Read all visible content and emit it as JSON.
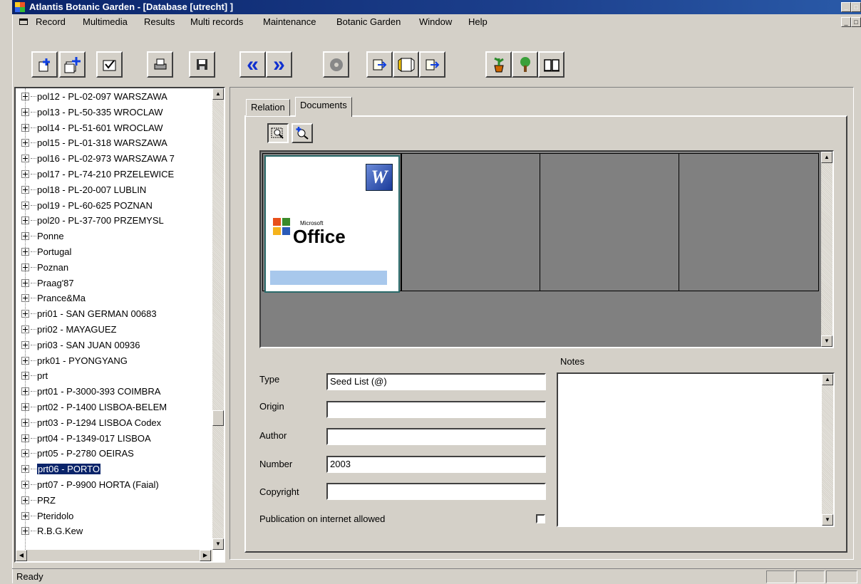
{
  "window": {
    "title": "Atlantis Botanic Garden - [Database [utrecht] ]"
  },
  "menu": [
    "Record",
    "Multimedia",
    "Results",
    "Multi records",
    "Maintenance",
    "Botanic Garden",
    "Window",
    "Help"
  ],
  "toolbar": {
    "buttons": [
      "new-record-icon",
      "new-multi-record-icon",
      "check-mark-icon",
      "print-icon",
      "save-icon",
      "previous-icon",
      "next-icon",
      "cd-icon",
      "export-icon",
      "book-frame-icon",
      "import-icon",
      "plant-pot-icon",
      "tree-icon",
      "open-book-icon"
    ],
    "prev_glyph": "«",
    "next_glyph": "»"
  },
  "tree": {
    "items": [
      "pol12 - PL-02-097  WARSZAWA",
      "pol13 - PL-50-335  WROCLAW",
      "pol14 - PL-51-601  WROCLAW",
      "pol15 - PL-01-318 WARSZAWA",
      "pol16 - PL-02-973  WARSZAWA 7",
      "pol17 - PL-74-210  PRZELEWICE",
      "pol18 - PL-20-007  LUBLIN",
      "pol19 - PL-60-625  POZNAN",
      "pol20 - PL-37-700  PRZEMYSL",
      "Ponne",
      "Portugal",
      "Poznan",
      "Praag'87",
      "Prance&Ma",
      "pri01 - SAN GERMAN 00683",
      "pri02 - MAYAGUEZ",
      "pri03 - SAN JUAN 00936",
      "prk01 - PYONGYANG",
      "prt",
      "prt01 - P-3000-393 COIMBRA",
      "prt02 - P-1400 LISBOA-BELEM",
      "prt03 - P-1294  LISBOA Codex",
      "prt04 - P-1349-017  LISBOA",
      "prt05 - P-2780 OEIRAS",
      "prt06 - PORTO",
      "prt07 - P-9900 HORTA (Faial)",
      "PRZ",
      "Pteridolo",
      "R.B.G.Kew"
    ],
    "selected": "prt06 - PORTO"
  },
  "tabs": {
    "relation": "Relation",
    "documents": "Documents"
  },
  "document": {
    "thumb_brand_small": "Microsoft",
    "thumb_brand": "Office",
    "thumb_word": "W"
  },
  "form": {
    "type_label": "Type",
    "type_value": "Seed List (@)",
    "origin_label": "Origin",
    "origin_value": "",
    "author_label": "Author",
    "author_value": "",
    "number_label": "Number",
    "number_value": "2003",
    "copyright_label": "Copyright",
    "copyright_value": "",
    "internet_label": "Publication on internet allowed",
    "internet_allowed": false,
    "notes_label": "Notes",
    "notes_value": ""
  },
  "status": {
    "text": "Ready"
  }
}
